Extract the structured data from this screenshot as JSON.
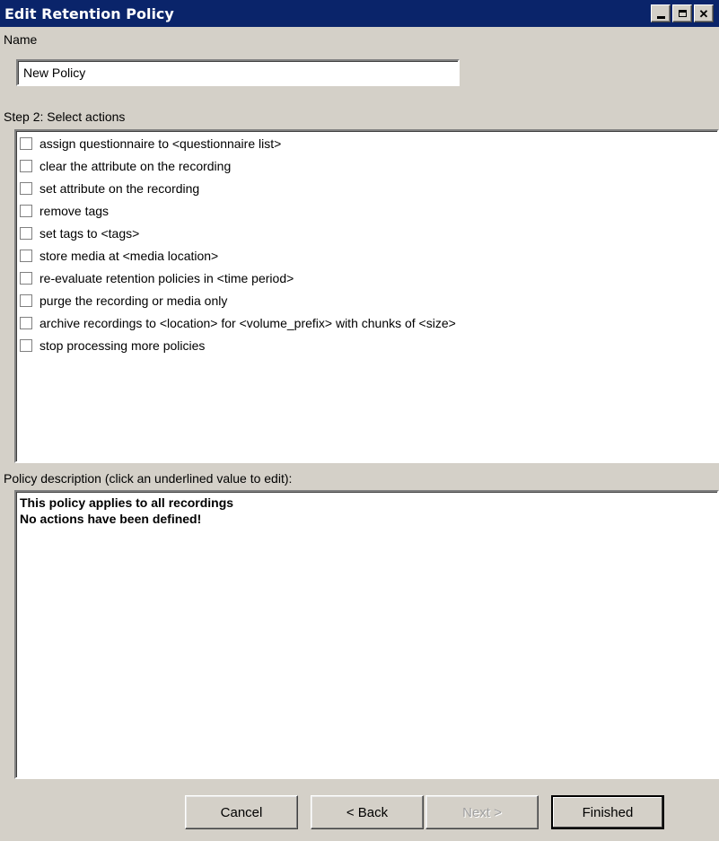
{
  "window": {
    "title": "Edit Retention Policy",
    "controls": [
      "minimize",
      "maximize",
      "close"
    ]
  },
  "name_section": {
    "label": "Name",
    "value": "New Policy"
  },
  "actions_section": {
    "label": "Step 2: Select actions",
    "items": [
      {
        "label": "assign  questionnaire  to  <questionnaire list>",
        "checked": false
      },
      {
        "label": "clear the attribute on the recording",
        "checked": false
      },
      {
        "label": "set attribute on the recording",
        "checked": false
      },
      {
        "label": "remove tags",
        "checked": false
      },
      {
        "label": "set tags to <tags>",
        "checked": false
      },
      {
        "label": "store media at <media location>",
        "checked": false
      },
      {
        "label": "re-evaluate  retention  policies  in  <time period>",
        "checked": false
      },
      {
        "label": "purge the recording or media only",
        "checked": false
      },
      {
        "label": "archive recordings to <location> for <volume_prefix> with chunks of <size>",
        "checked": false
      },
      {
        "label": "stop processing more policies",
        "checked": false
      }
    ]
  },
  "description_section": {
    "label": "Policy description (click an underlined value to edit):",
    "lines": [
      "This policy applies to all recordings",
      "No actions have been defined!"
    ]
  },
  "buttons": {
    "cancel": "Cancel",
    "back": "< Back",
    "next": "Next >",
    "finished": "Finished"
  },
  "icons": {
    "minimize": "minimize-icon",
    "maximize": "maximize-icon",
    "close": "close-icon"
  }
}
